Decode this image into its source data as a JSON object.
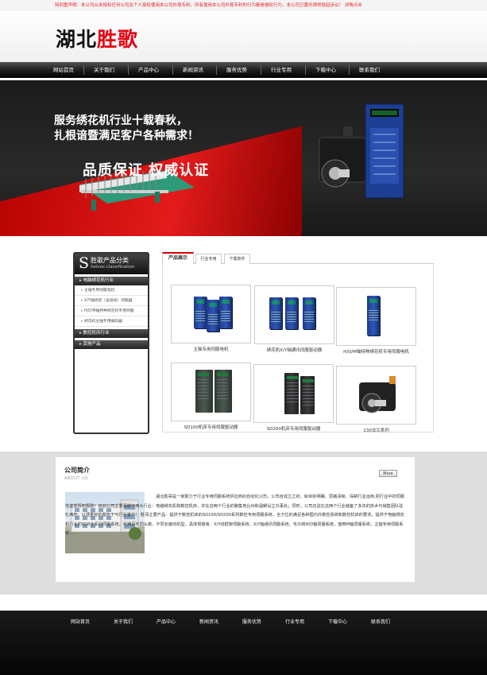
{
  "notice": "特别重声明：本公司从未授权任何公司及个人授权使用本公司外观专利，所有使用本公司外观专利的行为都是侵权行为，本公司已委托律师提起诉讼！ 详情点击",
  "logo": {
    "part1": "湖北",
    "part2": "胜歌"
  },
  "nav": [
    "网站首页",
    "关于我们",
    "产品中心",
    "新闻资讯",
    "服务优势",
    "行业专用",
    "下载中心",
    "联系我们"
  ],
  "banner": {
    "line1": "服务绣花机行业十载春秋，",
    "line2": "扎根谙暨满足客户各种需求！",
    "slogan": "品质保证  权威认证"
  },
  "sidebar": {
    "letter": "S",
    "title": "胜歌产品分类",
    "subtitle": "helves classification",
    "groups": [
      {
        "name": "电脑绣花机行业",
        "items": [
          "主轴专用伺服电机",
          "X/Y轴绕控（含送线）伺服器",
          "H/D/M轴特种绣花机专用伺服",
          "绣花机主轴专用编码器"
        ]
      },
      {
        "name": "数控机床行业",
        "items": []
      },
      {
        "name": "其他产品",
        "items": []
      }
    ]
  },
  "tabs": [
    "产品展示",
    "行业专用",
    "下载软件"
  ],
  "products": [
    {
      "caption": "主轴专用伺服电机"
    },
    {
      "caption": "绣花机X/Y轴通讯伺服驱动器"
    },
    {
      "caption": "H/D/M轴特种绣花机专用伺服电机"
    },
    {
      "caption": "SD100机床专用伺服驱动器"
    },
    {
      "caption": "SD200机床专用伺服驱动器"
    },
    {
      "caption": "130法兰系列"
    }
  ],
  "about": {
    "title": "公司简介",
    "subtitle": "ABOUT US",
    "more": "More",
    "text": "湖北胜哥是一家致力于行业专用伺服系统供应商的自动化公司，公司自成立之初，就目标明确、思路清晰、深耕行业运用,把行业中的伺服性能发挥到极致！目前公司主要深耕于两大行业：电脑绣花机和数控机床，并在这两个行业的聚集地台州和温暖设立办事处；同时，公司还驻在这两个行业储备了多年的技术与销售团队驻扎两地；以便更好的服务于与行业客户！ 胜哥主要产品：提供于数控机床的SD100/SD200系列数控专用伺服系统，全方位的满足各种国内外数控系统和数控机床的要求。提供于电脑绣花机行业的SD8全系列伺服系统，可满足不同头数、不同长度的机型，具体规格有：X/Y绕框架伺服系统、X/Y轴通讯伺服系统、毛巾绣H/D轴伺服系统，盘带M轴伺服系统，主轴专用伺服系统......"
  },
  "footer_nav": [
    "网站首页",
    "关于我们",
    "产品中心",
    "新闻资讯",
    "服务优势",
    "行业专用",
    "下载中心",
    "联系我们"
  ]
}
